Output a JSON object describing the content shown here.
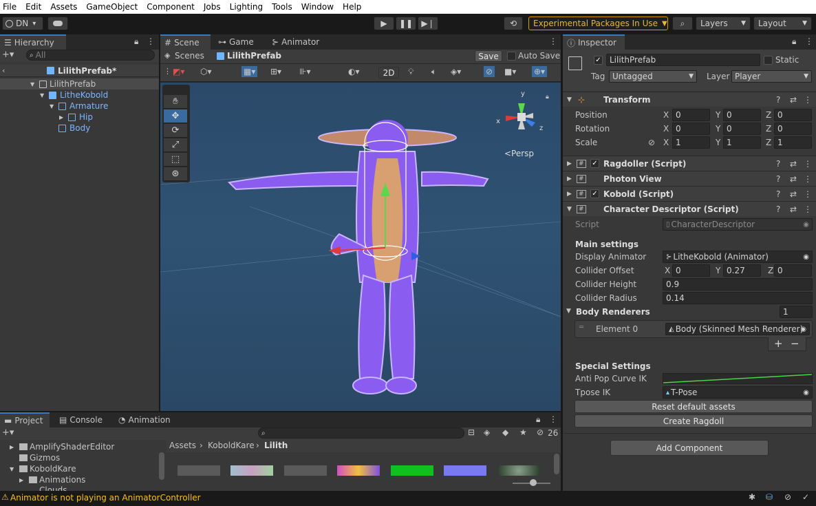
{
  "menu": [
    "File",
    "Edit",
    "Assets",
    "GameObject",
    "Component",
    "Jobs",
    "Lighting",
    "Tools",
    "Window",
    "Help"
  ],
  "toolbar": {
    "account": "DN",
    "account_arrow": "▾",
    "experimental": "Experimental Packages In Use",
    "layers": "Layers",
    "layout": "Layout"
  },
  "hierarchy": {
    "tab": "Hierarchy",
    "search_placeholder": "All",
    "scene_title": "LilithPrefab*",
    "items": [
      {
        "label": "LilithPrefab"
      },
      {
        "label": "LitheKobold"
      },
      {
        "label": "Armature"
      },
      {
        "label": "Hip"
      },
      {
        "label": "Body"
      }
    ]
  },
  "scene": {
    "tabs": [
      "Scene",
      "Game",
      "Animator"
    ],
    "breadcrumb_root": "Scenes",
    "breadcrumb_prefab": "LilithPrefab",
    "save": "Save",
    "auto_save": "Auto Save",
    "mode_2d": "2D",
    "persp": "<Persp",
    "axis_y": "y",
    "axis_x": "x",
    "axis_z": "z"
  },
  "inspector": {
    "tab": "Inspector",
    "object_name": "LilithPrefab",
    "static_label": "Static",
    "tag_label": "Tag",
    "tag_value": "Untagged",
    "layer_label": "Layer",
    "layer_value": "Player",
    "transform": {
      "title": "Transform",
      "position_label": "Position",
      "rotation_label": "Rotation",
      "scale_label": "Scale",
      "axis_x": "X",
      "axis_y": "Y",
      "axis_z": "Z",
      "position": [
        "0",
        "0",
        "0"
      ],
      "rotation": [
        "0",
        "0",
        "0"
      ],
      "scale": [
        "1",
        "1",
        "1"
      ]
    },
    "components": [
      "Ragdoller (Script)",
      "Photon View",
      "Kobold (Script)",
      "Character Descriptor (Script)"
    ],
    "descriptor": {
      "script_label": "Script",
      "script_value": "CharacterDescriptor",
      "main_settings": "Main settings",
      "display_animator_label": "Display Animator",
      "display_animator_value": "LitheKobold (Animator)",
      "collider_offset_label": "Collider Offset",
      "collider_offset": [
        "0",
        "0.27",
        "0"
      ],
      "collider_height_label": "Collider Height",
      "collider_height_value": "0.9",
      "collider_radius_label": "Collider Radius",
      "collider_radius_value": "0.14",
      "body_renderers_label": "Body Renderers",
      "body_renderers_count": "1",
      "element0_label": "Element 0",
      "element0_value": "Body (Skinned Mesh Renderer)",
      "plus": "+",
      "minus": "−",
      "special_settings": "Special Settings",
      "anti_pop_label": "Anti Pop Curve IK",
      "tpose_label": "Tpose IK",
      "tpose_value": "T-Pose",
      "reset_button": "Reset default assets",
      "create_ragdoll": "Create Ragdoll"
    },
    "add_component": "Add Component"
  },
  "project": {
    "tabs": [
      "Project",
      "Console",
      "Animation"
    ],
    "breadcrumb": [
      "Assets",
      "KoboldKare",
      "Lilith"
    ],
    "breadcrumb_sep": "›",
    "hidden_count": "26",
    "folders": [
      "AmplifyShaderEditor",
      "Gizmos",
      "KoboldKare",
      "Animations",
      "Clouds"
    ]
  },
  "status": {
    "message": "Animator is not playing an AnimatorController"
  },
  "colors": {
    "accent": "#3a79bb",
    "experimental_border": "#d89b00",
    "warning": "#f4c01e",
    "character": "#8a5cf0"
  }
}
